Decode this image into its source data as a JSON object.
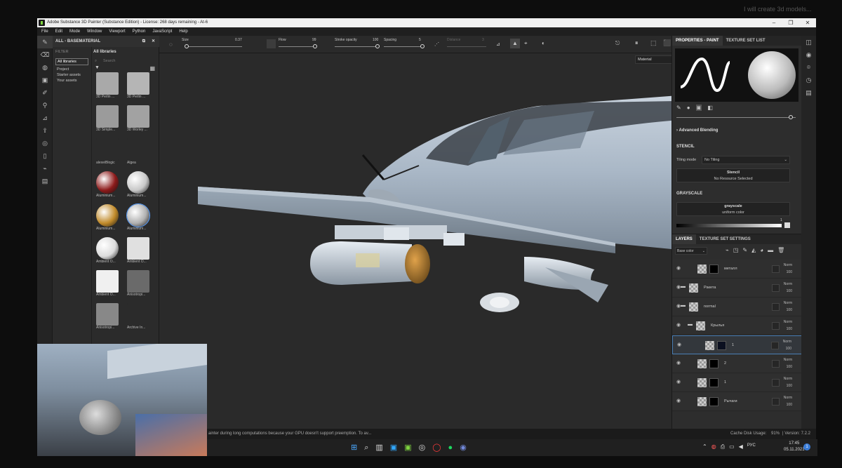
{
  "window": {
    "title": "Adobe Substance 3D Painter (Substance Edition) - License: 268 days remaining - At-6",
    "controls": [
      "–",
      "❐",
      "✕"
    ]
  },
  "menu": [
    "File",
    "Edit",
    "Mode",
    "Window",
    "Viewport",
    "Python",
    "JavaScript",
    "Help"
  ],
  "shelf": {
    "title": "ALL - BASEMATERIAL",
    "filter_label": "FILTER",
    "tree": [
      "All libraries",
      "Project",
      "Starter assets",
      "Your assets"
    ],
    "crumb": "All libraries",
    "search_placeholder": "Search",
    "items": [
      {
        "label": "3D Perlin ...",
        "color": "#a9a9a9"
      },
      {
        "label": "3D Perlin ...",
        "color": "#b5b5b5"
      },
      {
        "label": "3D Simple...",
        "color": "#9b9b9b"
      },
      {
        "label": "3D Worley ...",
        "color": "#a2a2a2"
      },
      {
        "label": "alexeiBlogic",
        "color": "#2b2b2b"
      },
      {
        "label": "Algea",
        "color": "#2b2b2b"
      },
      {
        "label": "Aluminium...",
        "color": "#8c1a1a"
      },
      {
        "label": "Aluminium...",
        "color": "#c8c8c8"
      },
      {
        "label": "Aluminium...",
        "color": "#c08a2a"
      },
      {
        "label": "Aluminium...",
        "color": "#b0b0b0"
      },
      {
        "label": "Ambient O...",
        "color": "#dcdcdc"
      },
      {
        "label": "Ambient O...",
        "color": "#e0e0e0"
      },
      {
        "label": "Ambient O...",
        "color": "#f0f0f0"
      },
      {
        "label": "Anisotropi...",
        "color": "#6a6a6a"
      },
      {
        "label": "Anisotropi...",
        "color": "#888888"
      },
      {
        "label": "Archive In...",
        "color": "#2b2b2b"
      }
    ]
  },
  "toolbar": {
    "size_label": "Size",
    "size_value": "0.37",
    "flow_label": "Flow",
    "flow_value": "99",
    "stroke_label": "Stroke opacity",
    "stroke_value": "100",
    "spacing_label": "Spacing",
    "spacing_value": "5",
    "stabilizer_label": "Distance",
    "stabilizer_value": "3",
    "material_select": "Material"
  },
  "properties": {
    "tabs": [
      "PROPERTIES - PAINT",
      "TEXTURE SET LIST"
    ],
    "advanced": "Advanced Blending",
    "stencil_head": "STENCIL",
    "tiling_label": "Tiling mode",
    "tiling_value": "No Tiling",
    "stencil_title": "Stencil",
    "stencil_sub": "No Resource Selected",
    "grayscale_head": "GRAYSCALE",
    "grayscale_title": "grayscale",
    "grayscale_sub": "uniform color",
    "slider_value": "1"
  },
  "layers": {
    "tabs": [
      "LAYERS",
      "TEXTURE SET SETTINGS"
    ],
    "channel": "Base color",
    "rows": [
      {
        "name": "металл",
        "blend": "Norm",
        "opacity": "100",
        "mask": "#000"
      },
      {
        "name": "Ракета",
        "blend": "Norm",
        "opacity": "100",
        "mask": ""
      },
      {
        "name": "normal",
        "blend": "Norm",
        "opacity": "100",
        "mask": ""
      },
      {
        "name": "Крылья",
        "blend": "Norm",
        "opacity": "100",
        "mask": ""
      },
      {
        "name": "1",
        "blend": "Norm",
        "opacity": "100",
        "mask": "#0b1020"
      },
      {
        "name": "2",
        "blend": "Norm",
        "opacity": "100",
        "mask": "#000"
      },
      {
        "name": "1",
        "blend": "Norm",
        "opacity": "100",
        "mask": "#000"
      },
      {
        "name": "Рычаги",
        "blend": "Norm",
        "opacity": "100",
        "mask": "#000"
      }
    ]
  },
  "status": {
    "message": "ainter during long computations because your GPU doesn't support preemption. To av...",
    "cache": "Cache Disk Usage:",
    "cache_pct": "91%",
    "version": "| Version: 7.2.2"
  },
  "taskbar": {
    "lang": "РУС",
    "time": "17:45",
    "date": "05.11.2021"
  },
  "background": {
    "side_text": "I will create 3d models..."
  }
}
